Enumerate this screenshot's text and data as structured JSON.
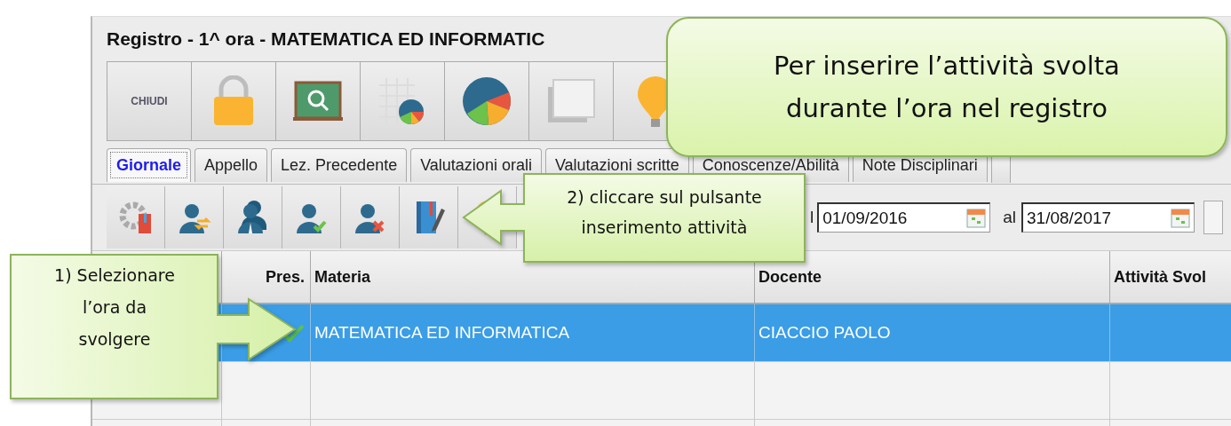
{
  "window": {
    "title": "Registro - 1^ ora - MATEMATICA ED INFORMATIC"
  },
  "toolbar": {
    "buttons": [
      {
        "kind": "text",
        "label": "CHIUDI"
      },
      {
        "kind": "lock"
      },
      {
        "kind": "board"
      },
      {
        "kind": "grid_chart"
      },
      {
        "kind": "pie"
      },
      {
        "kind": "windows"
      },
      {
        "kind": "bulb"
      }
    ]
  },
  "tabs": [
    {
      "label": "Giornale",
      "selected": true
    },
    {
      "label": "Appello",
      "selected": false
    },
    {
      "label": "Lez. Precedente",
      "selected": false
    },
    {
      "label": "Valutazioni orali",
      "selected": false
    },
    {
      "label": "Valutazioni scritte",
      "selected": false
    },
    {
      "label": "Conoscenze/Abilità",
      "selected": false
    },
    {
      "label": "Note Disciplinari",
      "selected": false
    }
  ],
  "action_toolbar": {
    "buttons": [
      {
        "kind": "gear_book"
      },
      {
        "kind": "user_swap"
      },
      {
        "kind": "users"
      },
      {
        "kind": "user_check"
      },
      {
        "kind": "user_remove"
      },
      {
        "kind": "book_pencil"
      },
      {
        "kind": "bulb"
      }
    ],
    "from_label": "l",
    "from_value": "01/09/2016",
    "to_label": "al",
    "to_value": "31/08/2017"
  },
  "table": {
    "columns": [
      "Pres.",
      "Materia",
      "Docente",
      "Attività Svol"
    ],
    "rows": [
      {
        "selected": true,
        "present": true,
        "materia": "MATEMATICA ED INFORMATICA",
        "docente": "CIACCIO PAOLO"
      },
      {
        "selected": false,
        "present": false,
        "materia": "",
        "docente": ""
      },
      {
        "selected": false,
        "present": false,
        "materia": "",
        "docente": ""
      }
    ]
  },
  "callouts": [
    {
      "kind": "note",
      "lines": [
        "Per inserire l’attività svolta",
        "durante l’ora nel registro"
      ]
    },
    {
      "kind": "pointer_left",
      "lines": [
        "2) cliccare sul pulsante",
        "inserimento attività"
      ]
    },
    {
      "kind": "pointer_right",
      "lines": [
        "1) Selezionare",
        "l’ora da",
        "svolgere"
      ]
    }
  ]
}
